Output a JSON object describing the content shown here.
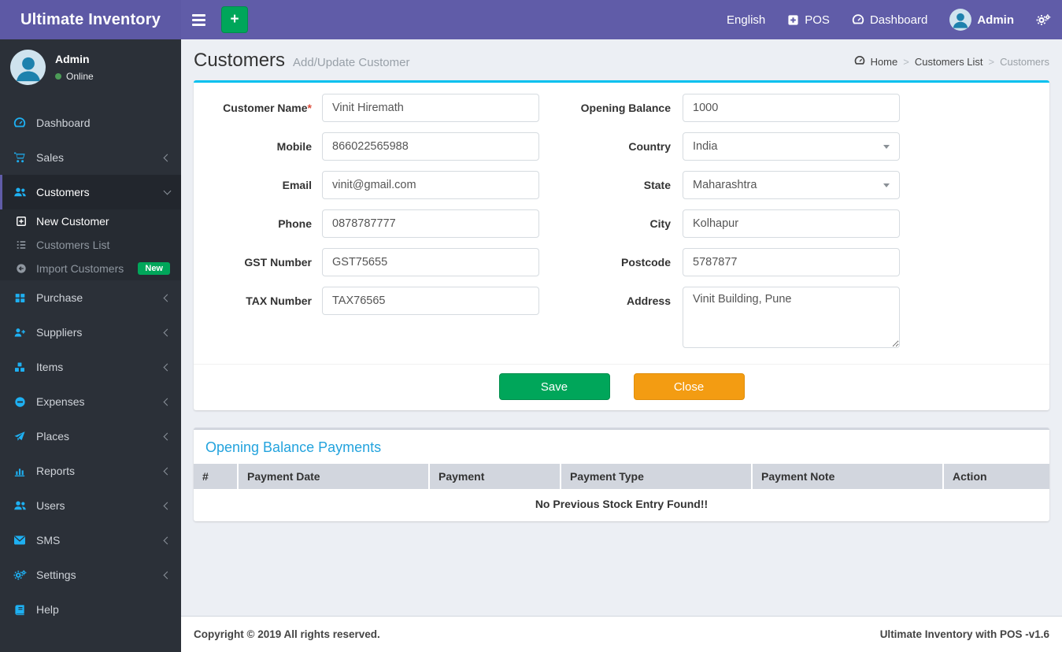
{
  "navbar": {
    "brand": "Ultimate Inventory",
    "language": "English",
    "pos": "POS",
    "dashboard": "Dashboard",
    "user": "Admin"
  },
  "sidebar": {
    "user": {
      "name": "Admin",
      "status": "Online"
    },
    "items": [
      {
        "label": "Dashboard"
      },
      {
        "label": "Sales"
      },
      {
        "label": "Customers",
        "submenu": [
          {
            "label": "New Customer"
          },
          {
            "label": "Customers List"
          },
          {
            "label": "Import Customers",
            "badge": "New"
          }
        ]
      },
      {
        "label": "Purchase"
      },
      {
        "label": "Suppliers"
      },
      {
        "label": "Items"
      },
      {
        "label": "Expenses"
      },
      {
        "label": "Places"
      },
      {
        "label": "Reports"
      },
      {
        "label": "Users"
      },
      {
        "label": "SMS"
      },
      {
        "label": "Settings"
      },
      {
        "label": "Help"
      }
    ]
  },
  "page": {
    "title": "Customers",
    "subtitle": "Add/Update Customer",
    "breadcrumb": {
      "home": "Home",
      "mid": "Customers List",
      "current": "Customers",
      "separator": ">"
    }
  },
  "form": {
    "left": [
      {
        "label": "Customer Name",
        "required_mark": "*",
        "value": "Vinit Hiremath"
      },
      {
        "label": "Mobile",
        "value": "866022565988"
      },
      {
        "label": "Email",
        "value": "vinit@gmail.com"
      },
      {
        "label": "Phone",
        "value": "0878787777"
      },
      {
        "label": "GST Number",
        "value": "GST75655"
      },
      {
        "label": "TAX Number",
        "value": "TAX76565"
      }
    ],
    "right": [
      {
        "label": "Opening Balance",
        "value": "1000"
      },
      {
        "label": "Country",
        "value": "India"
      },
      {
        "label": "State",
        "value": "Maharashtra"
      },
      {
        "label": "City",
        "value": "Kolhapur"
      },
      {
        "label": "Postcode",
        "value": "5787877"
      },
      {
        "label": "Address",
        "value": "Vinit Building, Pune"
      }
    ],
    "save_label": "Save",
    "close_label": "Close"
  },
  "payments": {
    "title": "Opening Balance Payments",
    "columns": [
      "#",
      "Payment Date",
      "Payment",
      "Payment Type",
      "Payment Note",
      "Action"
    ],
    "empty_message": "No Previous Stock Entry Found!!"
  },
  "footer": {
    "copyright": "Copyright © 2019 All rights reserved.",
    "version": "Ultimate Inventory with POS -v1.6"
  },
  "colors": {
    "navbar_purple": "#605ca8",
    "sidebar_dark": "#2b3038",
    "accent_cyan": "#00c0ef",
    "icon_blue": "#1eb0f2",
    "success_green": "#00a65a",
    "warning_orange": "#f39c12",
    "section_title_blue": "#23a3dd"
  }
}
